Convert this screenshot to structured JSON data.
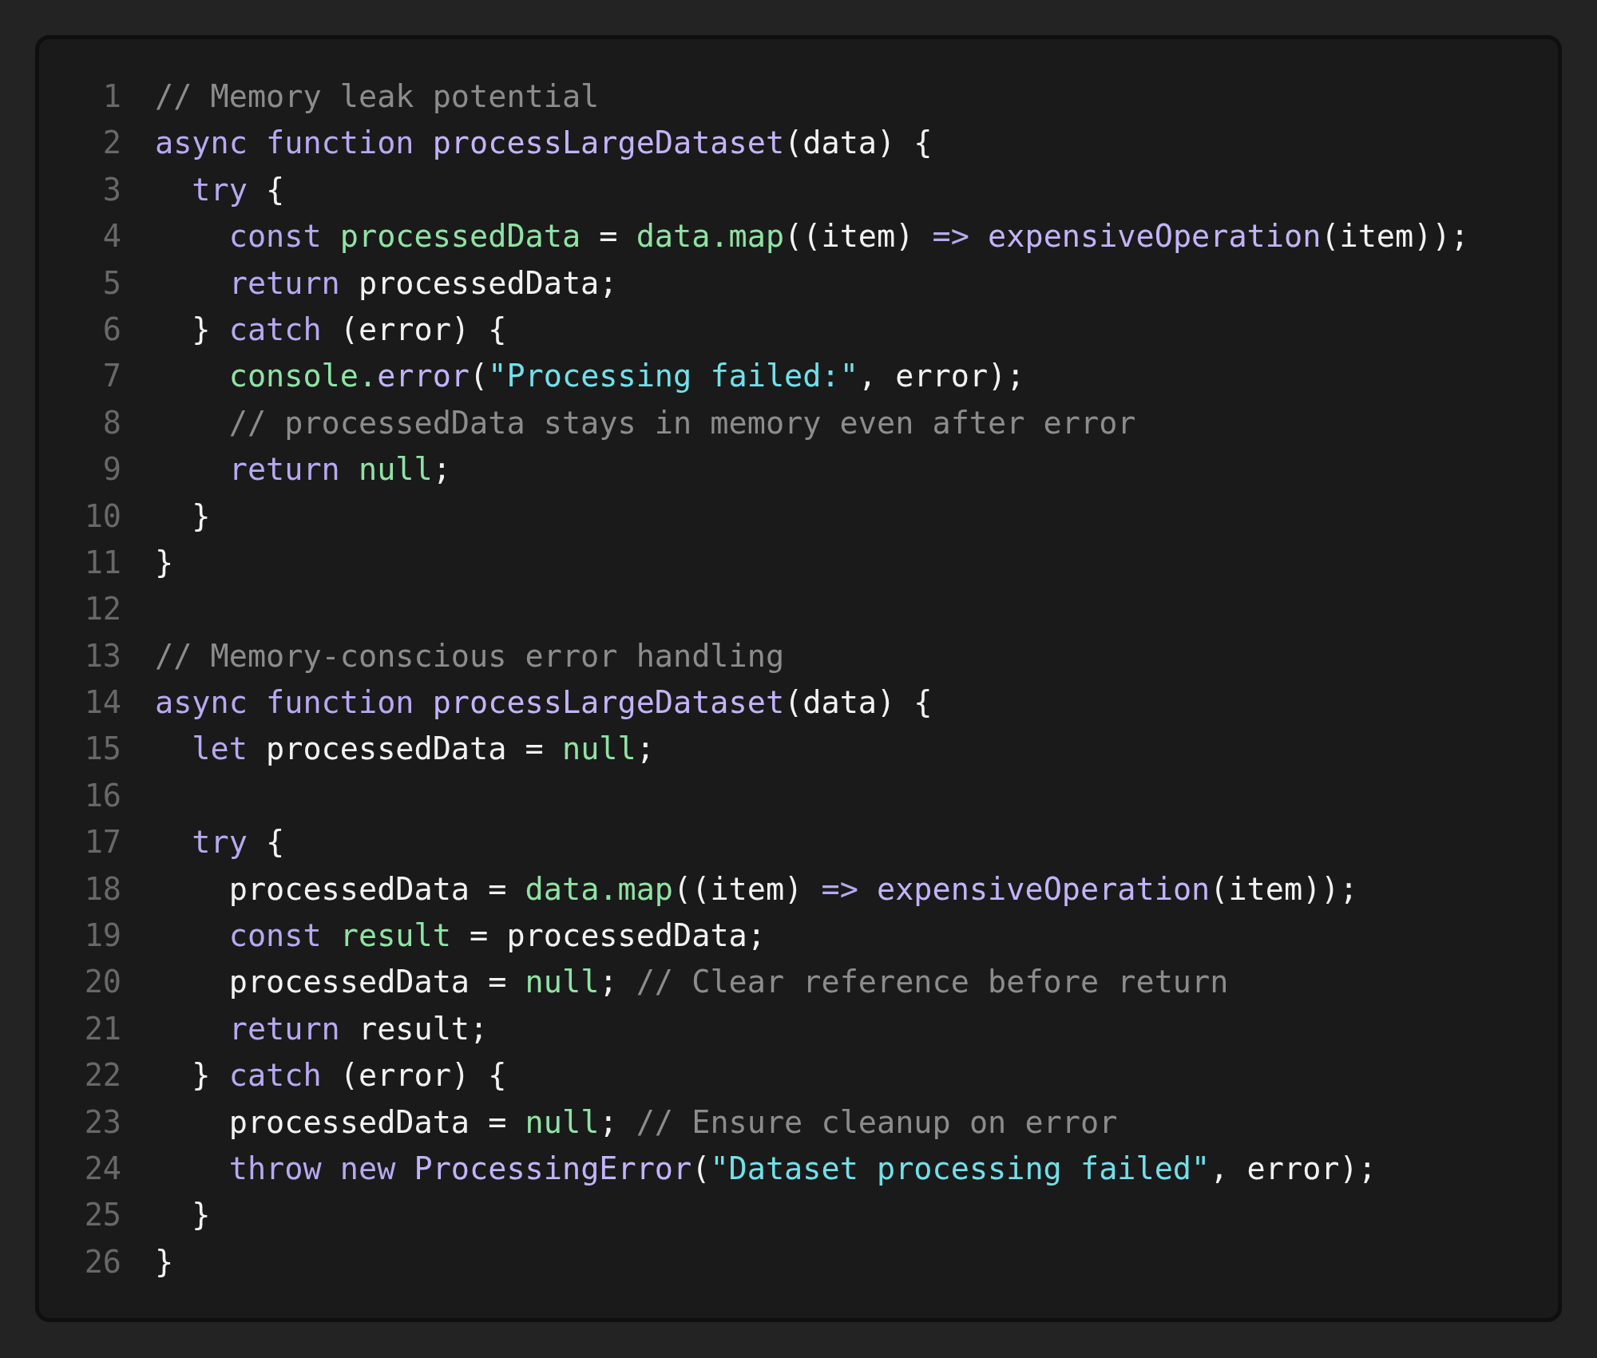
{
  "lines": [
    {
      "number": "1",
      "tokens": [
        {
          "kind": "comment",
          "text": "// Memory leak potential"
        }
      ]
    },
    {
      "number": "2",
      "tokens": [
        {
          "kind": "keyword",
          "text": "async function "
        },
        {
          "kind": "fn",
          "text": "processLargeDataset"
        },
        {
          "kind": "plain",
          "text": "(data) {"
        }
      ]
    },
    {
      "number": "3",
      "tokens": [
        {
          "kind": "keyword",
          "text": "  try"
        },
        {
          "kind": "plain",
          "text": " {"
        }
      ]
    },
    {
      "number": "4",
      "tokens": [
        {
          "kind": "keyword",
          "text": "    const "
        },
        {
          "kind": "var",
          "text": "processedData"
        },
        {
          "kind": "plain",
          "text": " = "
        },
        {
          "kind": "var",
          "text": "data.map"
        },
        {
          "kind": "plain",
          "text": "((item) "
        },
        {
          "kind": "keyword",
          "text": "=> "
        },
        {
          "kind": "fn",
          "text": "expensiveOperation"
        },
        {
          "kind": "plain",
          "text": "(item));"
        }
      ]
    },
    {
      "number": "5",
      "tokens": [
        {
          "kind": "keyword",
          "text": "    return"
        },
        {
          "kind": "plain",
          "text": " processedData;"
        }
      ]
    },
    {
      "number": "6",
      "tokens": [
        {
          "kind": "plain",
          "text": "  } "
        },
        {
          "kind": "keyword",
          "text": "catch"
        },
        {
          "kind": "plain",
          "text": " (error) {"
        }
      ]
    },
    {
      "number": "7",
      "tokens": [
        {
          "kind": "var",
          "text": "    console."
        },
        {
          "kind": "fn",
          "text": "error"
        },
        {
          "kind": "plain",
          "text": "("
        },
        {
          "kind": "string",
          "text": "\"Processing failed:\""
        },
        {
          "kind": "plain",
          "text": ", error);"
        }
      ]
    },
    {
      "number": "8",
      "tokens": [
        {
          "kind": "comment",
          "text": "    // processedData stays in memory even after error"
        }
      ]
    },
    {
      "number": "9",
      "tokens": [
        {
          "kind": "keyword",
          "text": "    return "
        },
        {
          "kind": "var",
          "text": "null"
        },
        {
          "kind": "plain",
          "text": ";"
        }
      ]
    },
    {
      "number": "10",
      "tokens": [
        {
          "kind": "plain",
          "text": "  }"
        }
      ]
    },
    {
      "number": "11",
      "tokens": [
        {
          "kind": "plain",
          "text": "}"
        }
      ]
    },
    {
      "number": "12"
    },
    {
      "number": "13",
      "tokens": [
        {
          "kind": "comment",
          "text": "// Memory-conscious error handling"
        }
      ]
    },
    {
      "number": "14",
      "tokens": [
        {
          "kind": "keyword",
          "text": "async function "
        },
        {
          "kind": "fn",
          "text": "processLargeDataset"
        },
        {
          "kind": "plain",
          "text": "(data) {"
        }
      ]
    },
    {
      "number": "15",
      "tokens": [
        {
          "kind": "keyword",
          "text": "  let"
        },
        {
          "kind": "plain",
          "text": " processedData = "
        },
        {
          "kind": "var",
          "text": "null"
        },
        {
          "kind": "plain",
          "text": ";"
        }
      ]
    },
    {
      "number": "16"
    },
    {
      "number": "17",
      "tokens": [
        {
          "kind": "keyword",
          "text": "  try"
        },
        {
          "kind": "plain",
          "text": " {"
        }
      ]
    },
    {
      "number": "18",
      "tokens": [
        {
          "kind": "plain",
          "text": "    processedData = "
        },
        {
          "kind": "var",
          "text": "data.map"
        },
        {
          "kind": "plain",
          "text": "((item) "
        },
        {
          "kind": "keyword",
          "text": "=> "
        },
        {
          "kind": "fn",
          "text": "expensiveOperation"
        },
        {
          "kind": "plain",
          "text": "(item));"
        }
      ]
    },
    {
      "number": "19",
      "tokens": [
        {
          "kind": "keyword",
          "text": "    const "
        },
        {
          "kind": "var",
          "text": "result"
        },
        {
          "kind": "plain",
          "text": " = processedData;"
        }
      ]
    },
    {
      "number": "20",
      "tokens": [
        {
          "kind": "plain",
          "text": "    processedData = "
        },
        {
          "kind": "var",
          "text": "null"
        },
        {
          "kind": "plain",
          "text": "; "
        },
        {
          "kind": "comment",
          "text": "// Clear reference before return"
        }
      ]
    },
    {
      "number": "21",
      "tokens": [
        {
          "kind": "keyword",
          "text": "    return"
        },
        {
          "kind": "plain",
          "text": " result;"
        }
      ]
    },
    {
      "number": "22",
      "tokens": [
        {
          "kind": "plain",
          "text": "  } "
        },
        {
          "kind": "keyword",
          "text": "catch"
        },
        {
          "kind": "plain",
          "text": " (error) {"
        }
      ]
    },
    {
      "number": "23",
      "tokens": [
        {
          "kind": "plain",
          "text": "    processedData = "
        },
        {
          "kind": "var",
          "text": "null"
        },
        {
          "kind": "plain",
          "text": "; "
        },
        {
          "kind": "comment",
          "text": "// Ensure cleanup on error"
        }
      ]
    },
    {
      "number": "24",
      "tokens": [
        {
          "kind": "keyword",
          "text": "    throw new "
        },
        {
          "kind": "fn",
          "text": "ProcessingError"
        },
        {
          "kind": "plain",
          "text": "("
        },
        {
          "kind": "string",
          "text": "\"Dataset processing failed\""
        },
        {
          "kind": "plain",
          "text": ", error);"
        }
      ]
    },
    {
      "number": "25",
      "tokens": [
        {
          "kind": "plain",
          "text": "  }"
        }
      ]
    },
    {
      "number": "26",
      "tokens": [
        {
          "kind": "plain",
          "text": "}"
        }
      ]
    }
  ]
}
